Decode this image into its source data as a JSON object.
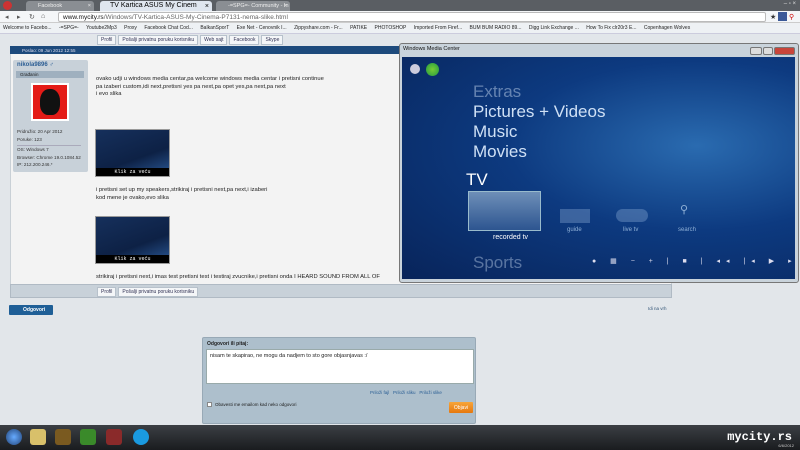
{
  "browser": {
    "tabs": [
      {
        "label": "Facebook"
      },
      {
        "label": "TV Kartica ASUS My Cinem"
      },
      {
        "label": "-=SPG=- Community - In"
      }
    ],
    "url_domain": "www.mycity.rs",
    "url_path": "/Windows/TV-Kartica-ASUS-My-Cinema-P7131-nema-slike.html",
    "bookmarks": [
      "Welcome to Facebo...",
      "-=SPG=-",
      "Youtube2Mp3",
      "Proxy",
      "Facebook Chat Cod...",
      "BalkanSporT",
      "Exe Net - Cenovnik I...",
      "Zippyshare.com - Fr...",
      "PATIKE",
      "PHOTOSHOP",
      "Imported From Firef...",
      "BUM BUM RADIO 89...",
      "Digg Link Exchange ...",
      "How To Fix clr20r3 E...",
      "Copenhagen Wolves"
    ]
  },
  "forum": {
    "top_buttons": [
      "Profil",
      "Pošalji privatnu poruku korisniku",
      "Web sajt",
      "Facebook",
      "Skype"
    ],
    "post_date": "Poslao: 09 Jun 2012 12:55",
    "user": {
      "name": "nikola9896 ♂",
      "rank": "Građanin",
      "joined": "Pridružio: 20 Apr 2012",
      "posts": "Poruke: 123",
      "os": "OS: Windows 7",
      "browser": "Browser: Chrome 19.0.1084.52",
      "ip": "IP: 212.200.246.*"
    },
    "msg1": [
      "ovako udji u windows media centar,pa welcome windows media centar i pretisni continue",
      "pa izaberi custom,idi next,pretisni yes pa next,pa opet yes,pa next,pa next",
      "i evo slika"
    ],
    "thumb_caption": "Klik za veću",
    "msg2": [
      "i pretisni set up my speakers,strikiraj i pretisni next,pa next,i izaberi",
      "kod mene je ovako,evo slika"
    ],
    "msg3": "strikiraj i pretisni next,i imas test pretisni test i testiraj zvucnike,i pretisni onda I HEARD SOUND FROM ALL OF",
    "foot_buttons": [
      "Profil",
      "Pošalji privatnu poruku korisniku"
    ],
    "reply_button": "Odgovori",
    "top_link": "Idi na vrh",
    "reply": {
      "label": "Odgovori ili pitaj:",
      "text": "nisam te skapirao, ne mogu da nadjem to sto gore objasnjavas :/",
      "attach": [
        "Priloži fajl",
        "Priloži sliku",
        "Priloži slike"
      ],
      "notify": "Obavesti me emailom kad neko odgovori",
      "submit": "Objavi"
    }
  },
  "wmc": {
    "title": "Windows Media Center",
    "menu": [
      "Extras",
      "Pictures + Videos",
      "Music",
      "Movies",
      "TV",
      "Sports"
    ],
    "tv_items": [
      "recorded tv",
      "guide",
      "live tv",
      "search"
    ],
    "controls": "● ▦ − + | ■ | ◂◂ |◂ ▶ ▸| ▸▸ | ◀) − +"
  },
  "taskbar": {
    "brand": "mycity.rs",
    "date": "6/6/2012"
  }
}
